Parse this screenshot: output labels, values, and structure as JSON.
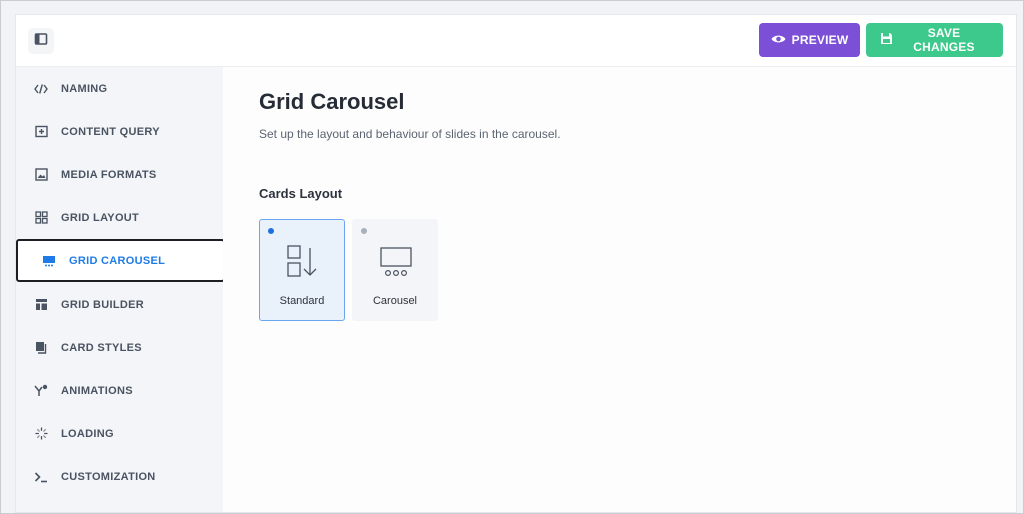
{
  "topbar": {
    "toggle_icon": "sidebar-toggle-icon",
    "preview_label": "PREVIEW",
    "save_label": "SAVE CHANGES",
    "preview_color": "#7b4fd6",
    "save_color": "#3ec98c"
  },
  "sidebar": {
    "items": [
      {
        "label": "NAMING",
        "icon": "code-icon"
      },
      {
        "label": "CONTENT QUERY",
        "icon": "folder-plus-icon"
      },
      {
        "label": "MEDIA FORMATS",
        "icon": "image-icon"
      },
      {
        "label": "GRID LAYOUT",
        "icon": "grid-icon"
      },
      {
        "label": "GRID CAROUSEL",
        "icon": "carousel-icon",
        "active": true
      },
      {
        "label": "GRID BUILDER",
        "icon": "layout-icon"
      },
      {
        "label": "CARD STYLES",
        "icon": "cards-icon"
      },
      {
        "label": "ANIMATIONS",
        "icon": "animation-icon"
      },
      {
        "label": "LOADING",
        "icon": "loading-icon"
      },
      {
        "label": "CUSTOMIZATION",
        "icon": "terminal-icon"
      }
    ],
    "active_color": "#1e7be8"
  },
  "main": {
    "title": "Grid Carousel",
    "subtitle": "Set up the layout and behaviour of slides in the carousel.",
    "section_label": "Cards Layout",
    "options": [
      {
        "label": "Standard",
        "icon": "standard-layout-icon",
        "selected": true
      },
      {
        "label": "Carousel",
        "icon": "carousel-layout-icon",
        "selected": false
      }
    ]
  }
}
